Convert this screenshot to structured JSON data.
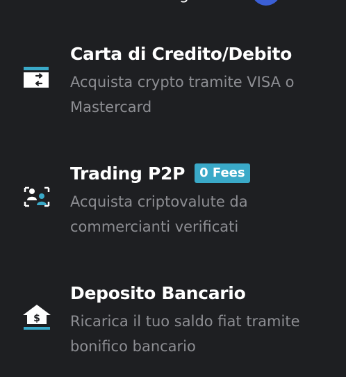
{
  "header": {
    "partial_text": "g"
  },
  "menu": {
    "items": [
      {
        "title": "Carta di Credito/Debito",
        "description": "Acquista crypto tramite VISA o Mastercard",
        "icon": "credit-card-icon"
      },
      {
        "title": "Trading P2P",
        "badge": "0 Fees",
        "description": "Acquista criptovalute da commercianti verificati",
        "icon": "p2p-users-icon"
      },
      {
        "title": "Deposito Bancario",
        "description": "Ricarica il tuo saldo fiat tramite bonifico bancario",
        "icon": "bank-deposit-icon"
      }
    ]
  },
  "colors": {
    "background": "#1e1f22",
    "accent": "#3aa9c8",
    "title": "#ffffff",
    "description": "#8d8e93"
  }
}
